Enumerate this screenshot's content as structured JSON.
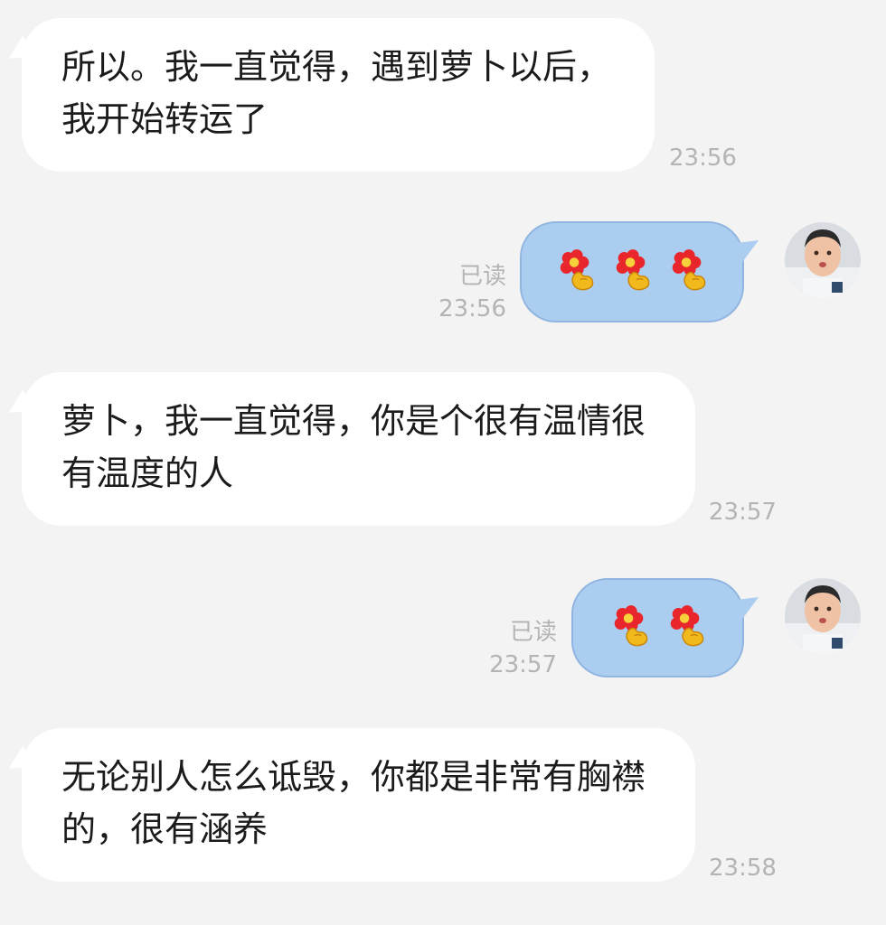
{
  "messages": [
    {
      "side": "in",
      "text": "所以。我一直觉得，遇到萝卜以后，我开始转运了",
      "time": "23:56"
    },
    {
      "side": "out",
      "emoji": [
        "flower-fist-emoji",
        "flower-fist-emoji",
        "flower-fist-emoji"
      ],
      "read": "已读",
      "time": "23:56"
    },
    {
      "side": "in",
      "text": "萝卜，我一直觉得，你是个很有温情很有温度的人",
      "time": "23:57"
    },
    {
      "side": "out",
      "emoji": [
        "flower-fist-emoji",
        "flower-fist-emoji"
      ],
      "read": "已读",
      "time": "23:57"
    },
    {
      "side": "in",
      "text": "无论别人怎么诋毁，你都是非常有胸襟的，很有涵养",
      "time": "23:58"
    }
  ],
  "colors": {
    "background": "#f3f3f3",
    "incoming_bubble": "#ffffff",
    "outgoing_bubble": "#abcdf0",
    "timestamp": "#b4b4b4"
  }
}
